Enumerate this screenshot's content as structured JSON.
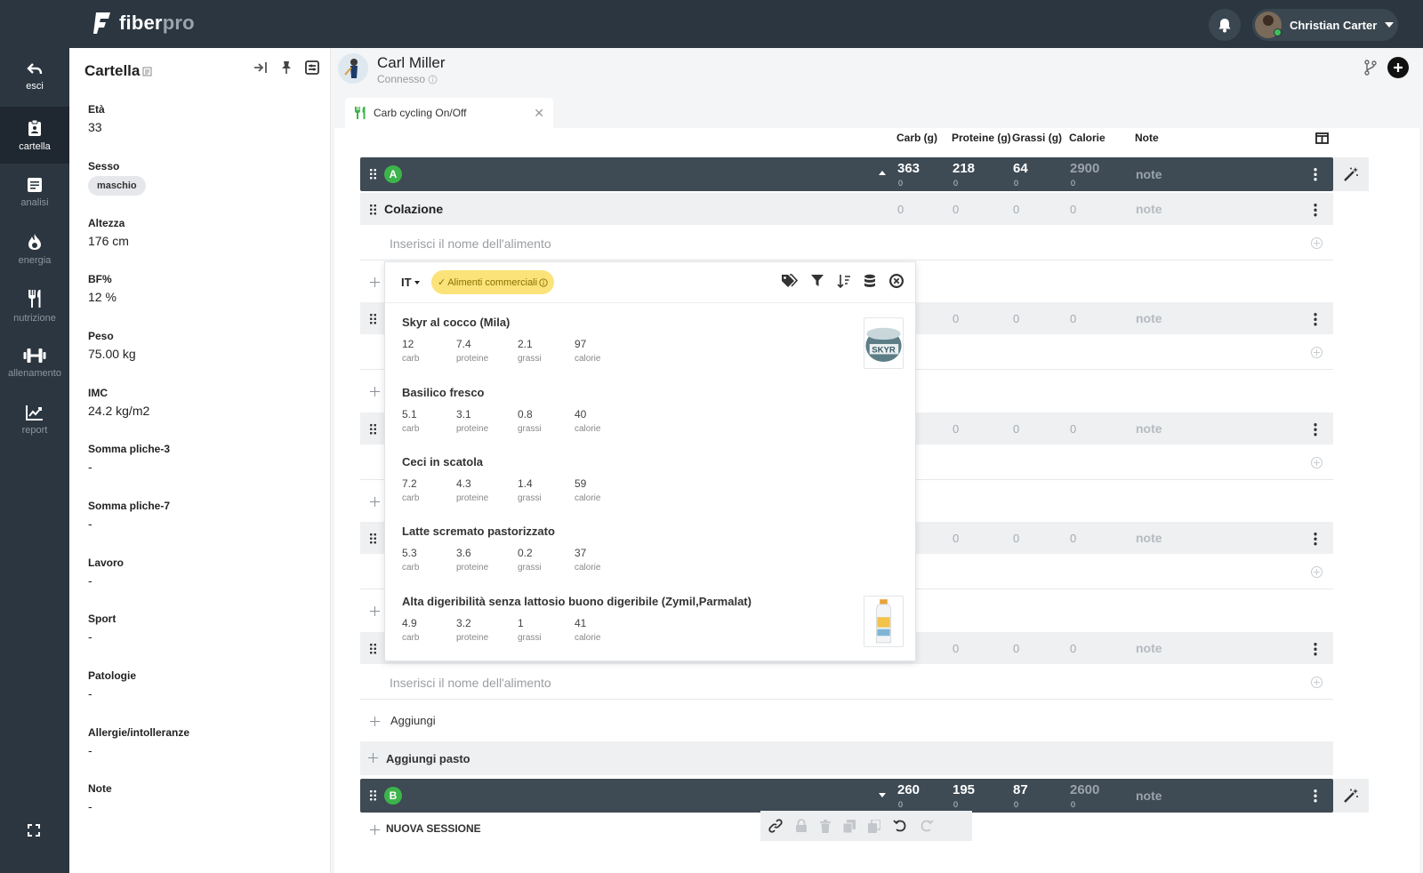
{
  "app": {
    "logo_name": "fiber",
    "logo_suffix": "pro"
  },
  "user": {
    "name": "Christian Carter"
  },
  "nav": [
    {
      "label": "esci",
      "icon": "back-arrow-icon"
    },
    {
      "label": "cartella",
      "icon": "clipboard-icon"
    },
    {
      "label": "analisi",
      "icon": "document-icon"
    },
    {
      "label": "energia",
      "icon": "flame-icon"
    },
    {
      "label": "nutrizione",
      "icon": "cutlery-icon"
    },
    {
      "label": "allenamento",
      "icon": "dumbbell-icon"
    },
    {
      "label": "report",
      "icon": "chart-line-icon"
    }
  ],
  "cartella": {
    "title": "Cartella",
    "fields": [
      {
        "label": "Età",
        "value": "33"
      },
      {
        "label": "Sesso",
        "value": "maschio"
      },
      {
        "label": "Altezza",
        "value": "176 cm"
      },
      {
        "label": "BF%",
        "value": "12 %"
      },
      {
        "label": "Peso",
        "value": "75.00 kg"
      },
      {
        "label": "IMC",
        "value": "24.2 kg/m2"
      },
      {
        "label": "Somma pliche-3",
        "value": "-"
      },
      {
        "label": "Somma pliche-7",
        "value": "-"
      },
      {
        "label": "Lavoro",
        "value": "-"
      },
      {
        "label": "Sport",
        "value": "-"
      },
      {
        "label": "Patologie",
        "value": "-"
      },
      {
        "label": "Allergie/intolleranze",
        "value": "-"
      },
      {
        "label": "Note",
        "value": "-"
      }
    ]
  },
  "patient": {
    "name": "Carl Miller",
    "status": "Connesso"
  },
  "tab": {
    "label": "Carb cycling On/Off"
  },
  "columns": {
    "carb": "Carb (g)",
    "proteine": "Proteine (g)",
    "grassi": "Grassi (g)",
    "calorie": "Calorie",
    "note": "Note"
  },
  "sessionA": {
    "badge": "A",
    "carb": "363",
    "proteine": "218",
    "grassi": "64",
    "calorie": "2900",
    "sub": "0",
    "note": "note"
  },
  "sessionB": {
    "badge": "B",
    "carb": "260",
    "proteine": "195",
    "grassi": "87",
    "calorie": "2600",
    "sub": "0",
    "note": "note"
  },
  "meal": {
    "title": "Colazione",
    "zero": "0",
    "note": "note"
  },
  "input_placeholder": "Inserisci il nome dell'alimento",
  "popup": {
    "lang": "IT",
    "filter": "Alimenti commerciali",
    "labels": {
      "carb": "carb",
      "proteine": "proteine",
      "grassi": "grassi",
      "calorie": "calorie"
    },
    "foods": [
      {
        "name": "Skyr al cocco (Mila)",
        "carb": "12",
        "proteine": "7.4",
        "grassi": "2.1",
        "calorie": "97"
      },
      {
        "name": "Basilico fresco",
        "carb": "5.1",
        "proteine": "3.1",
        "grassi": "0.8",
        "calorie": "40"
      },
      {
        "name": "Ceci in scatola",
        "carb": "7.2",
        "proteine": "4.3",
        "grassi": "1.4",
        "calorie": "59"
      },
      {
        "name": "Latte scremato pastorizzato",
        "carb": "5.3",
        "proteine": "3.6",
        "grassi": "0.2",
        "calorie": "37"
      },
      {
        "name": "Alta digeribilità senza lattosio buono digeribile (Zymil,Parmalat)",
        "carb": "4.9",
        "proteine": "3.2",
        "grassi": "1",
        "calorie": "41"
      }
    ],
    "skyr_label": "SKYR"
  },
  "actions": {
    "aggiungi": "Aggiungi",
    "aggiungi_pasto": "Aggiungi pasto",
    "nuova_sessione": "NUOVA SESSIONE"
  }
}
